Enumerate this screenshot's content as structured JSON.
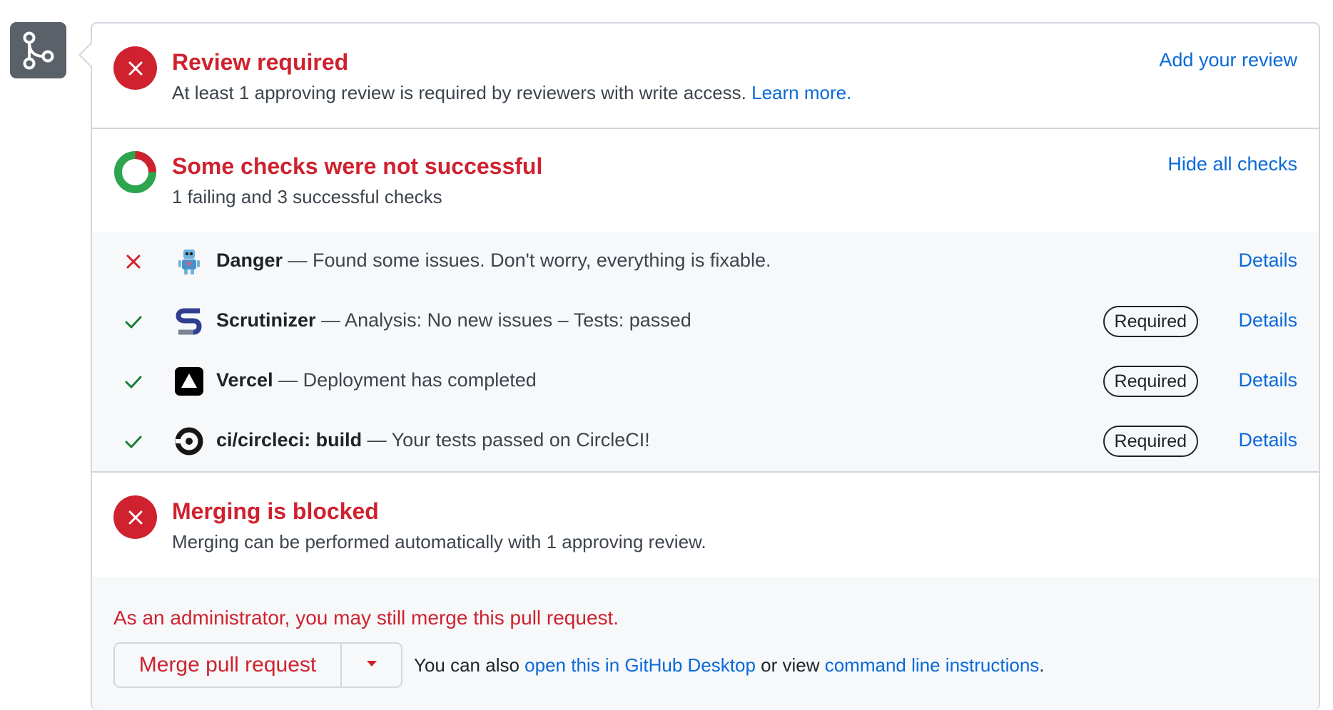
{
  "review": {
    "title": "Review required",
    "subtitle": "At least 1 approving review is required by reviewers with write access.",
    "learn_more": "Learn more.",
    "action": "Add your review"
  },
  "checks": {
    "title": "Some checks were not successful",
    "subtitle": "1 failing and 3 successful checks",
    "action": "Hide all checks",
    "items": [
      {
        "status": "failure",
        "icon": "danger-robot-icon",
        "name": "Danger",
        "description": " — Found some issues. Don't worry, everything is fixable.",
        "required": "",
        "details": "Details"
      },
      {
        "status": "success",
        "icon": "scrutinizer-logo-icon",
        "name": "Scrutinizer",
        "description": " — Analysis: No new issues – Tests: passed",
        "required": "Required",
        "details": "Details"
      },
      {
        "status": "success",
        "icon": "vercel-logo-icon",
        "name": "Vercel",
        "description": " — Deployment has completed",
        "required": "Required",
        "details": "Details"
      },
      {
        "status": "success",
        "icon": "circleci-logo-icon",
        "name": "ci/circleci: build",
        "description": " — Your tests passed on CircleCI!",
        "required": "Required",
        "details": "Details"
      }
    ]
  },
  "merge_status": {
    "title": "Merging is blocked",
    "subtitle": "Merging can be performed automatically with 1 approving review."
  },
  "admin": {
    "notice": "As an administrator, you may still merge this pull request.",
    "merge_button": "Merge pull request",
    "hint_prefix": "You can also ",
    "desktop_link": "open this in GitHub Desktop",
    "hint_middle": " or view ",
    "cli_link": "command line instructions",
    "hint_suffix": "."
  },
  "colors": {
    "danger": "#cf222e",
    "success": "#1a7f37",
    "link": "#0969da",
    "border": "#d0d7de"
  }
}
